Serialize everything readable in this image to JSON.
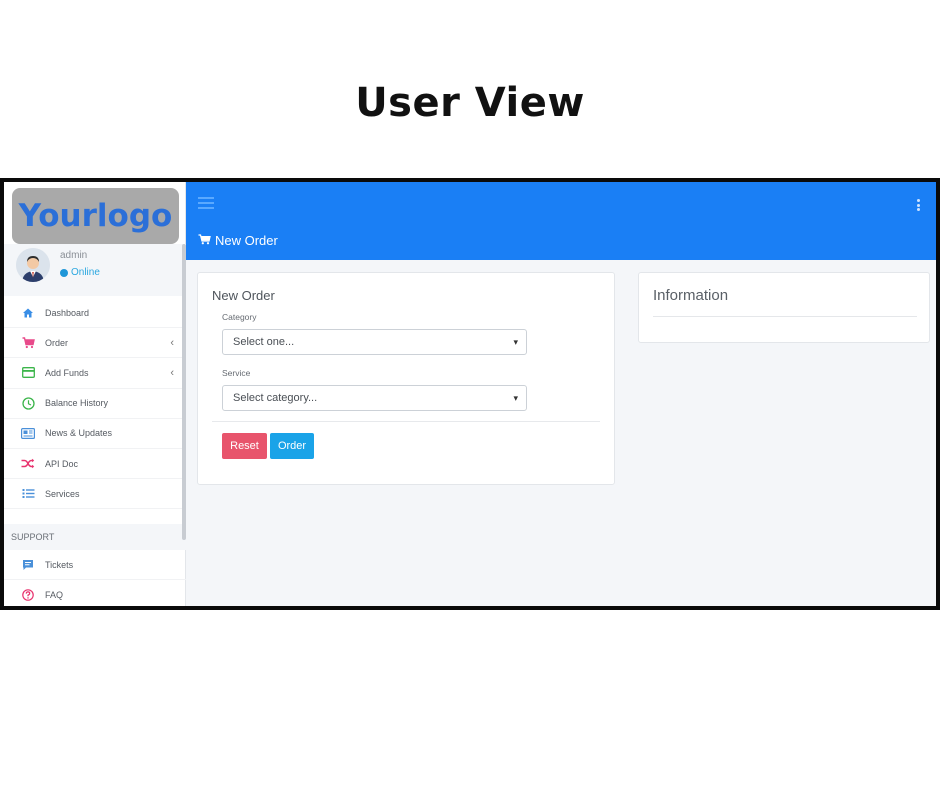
{
  "heading": "User View",
  "logo": "Yourlogo",
  "user": {
    "name": "admin",
    "status": "Online"
  },
  "nav": [
    {
      "label": "Dashboard",
      "icon": "home-icon"
    },
    {
      "label": "Order",
      "icon": "cart-icon"
    },
    {
      "label": "Add Funds",
      "icon": "credit-card-icon"
    },
    {
      "label": "Balance History",
      "icon": "clock-icon"
    },
    {
      "label": "News & Updates",
      "icon": "newspaper-icon"
    },
    {
      "label": "API Doc",
      "icon": "shuffle-icon"
    },
    {
      "label": "Services",
      "icon": "list-icon"
    }
  ],
  "support": {
    "header": "SUPPORT",
    "items": [
      {
        "label": "Tickets",
        "icon": "chat-icon"
      },
      {
        "label": "FAQ",
        "icon": "question-icon"
      }
    ]
  },
  "topbar": {
    "title": "New Order"
  },
  "order_form": {
    "title": "New Order",
    "category_label": "Category",
    "category_value": "Select one...",
    "service_label": "Service",
    "service_value": "Select category...",
    "reset_label": "Reset",
    "order_label": "Order"
  },
  "info": {
    "title": "Information"
  },
  "colors": {
    "primary": "#1a7ff5",
    "reset": "#e8546c",
    "order": "#1aa3e8",
    "logo": "#2b6fd8"
  }
}
